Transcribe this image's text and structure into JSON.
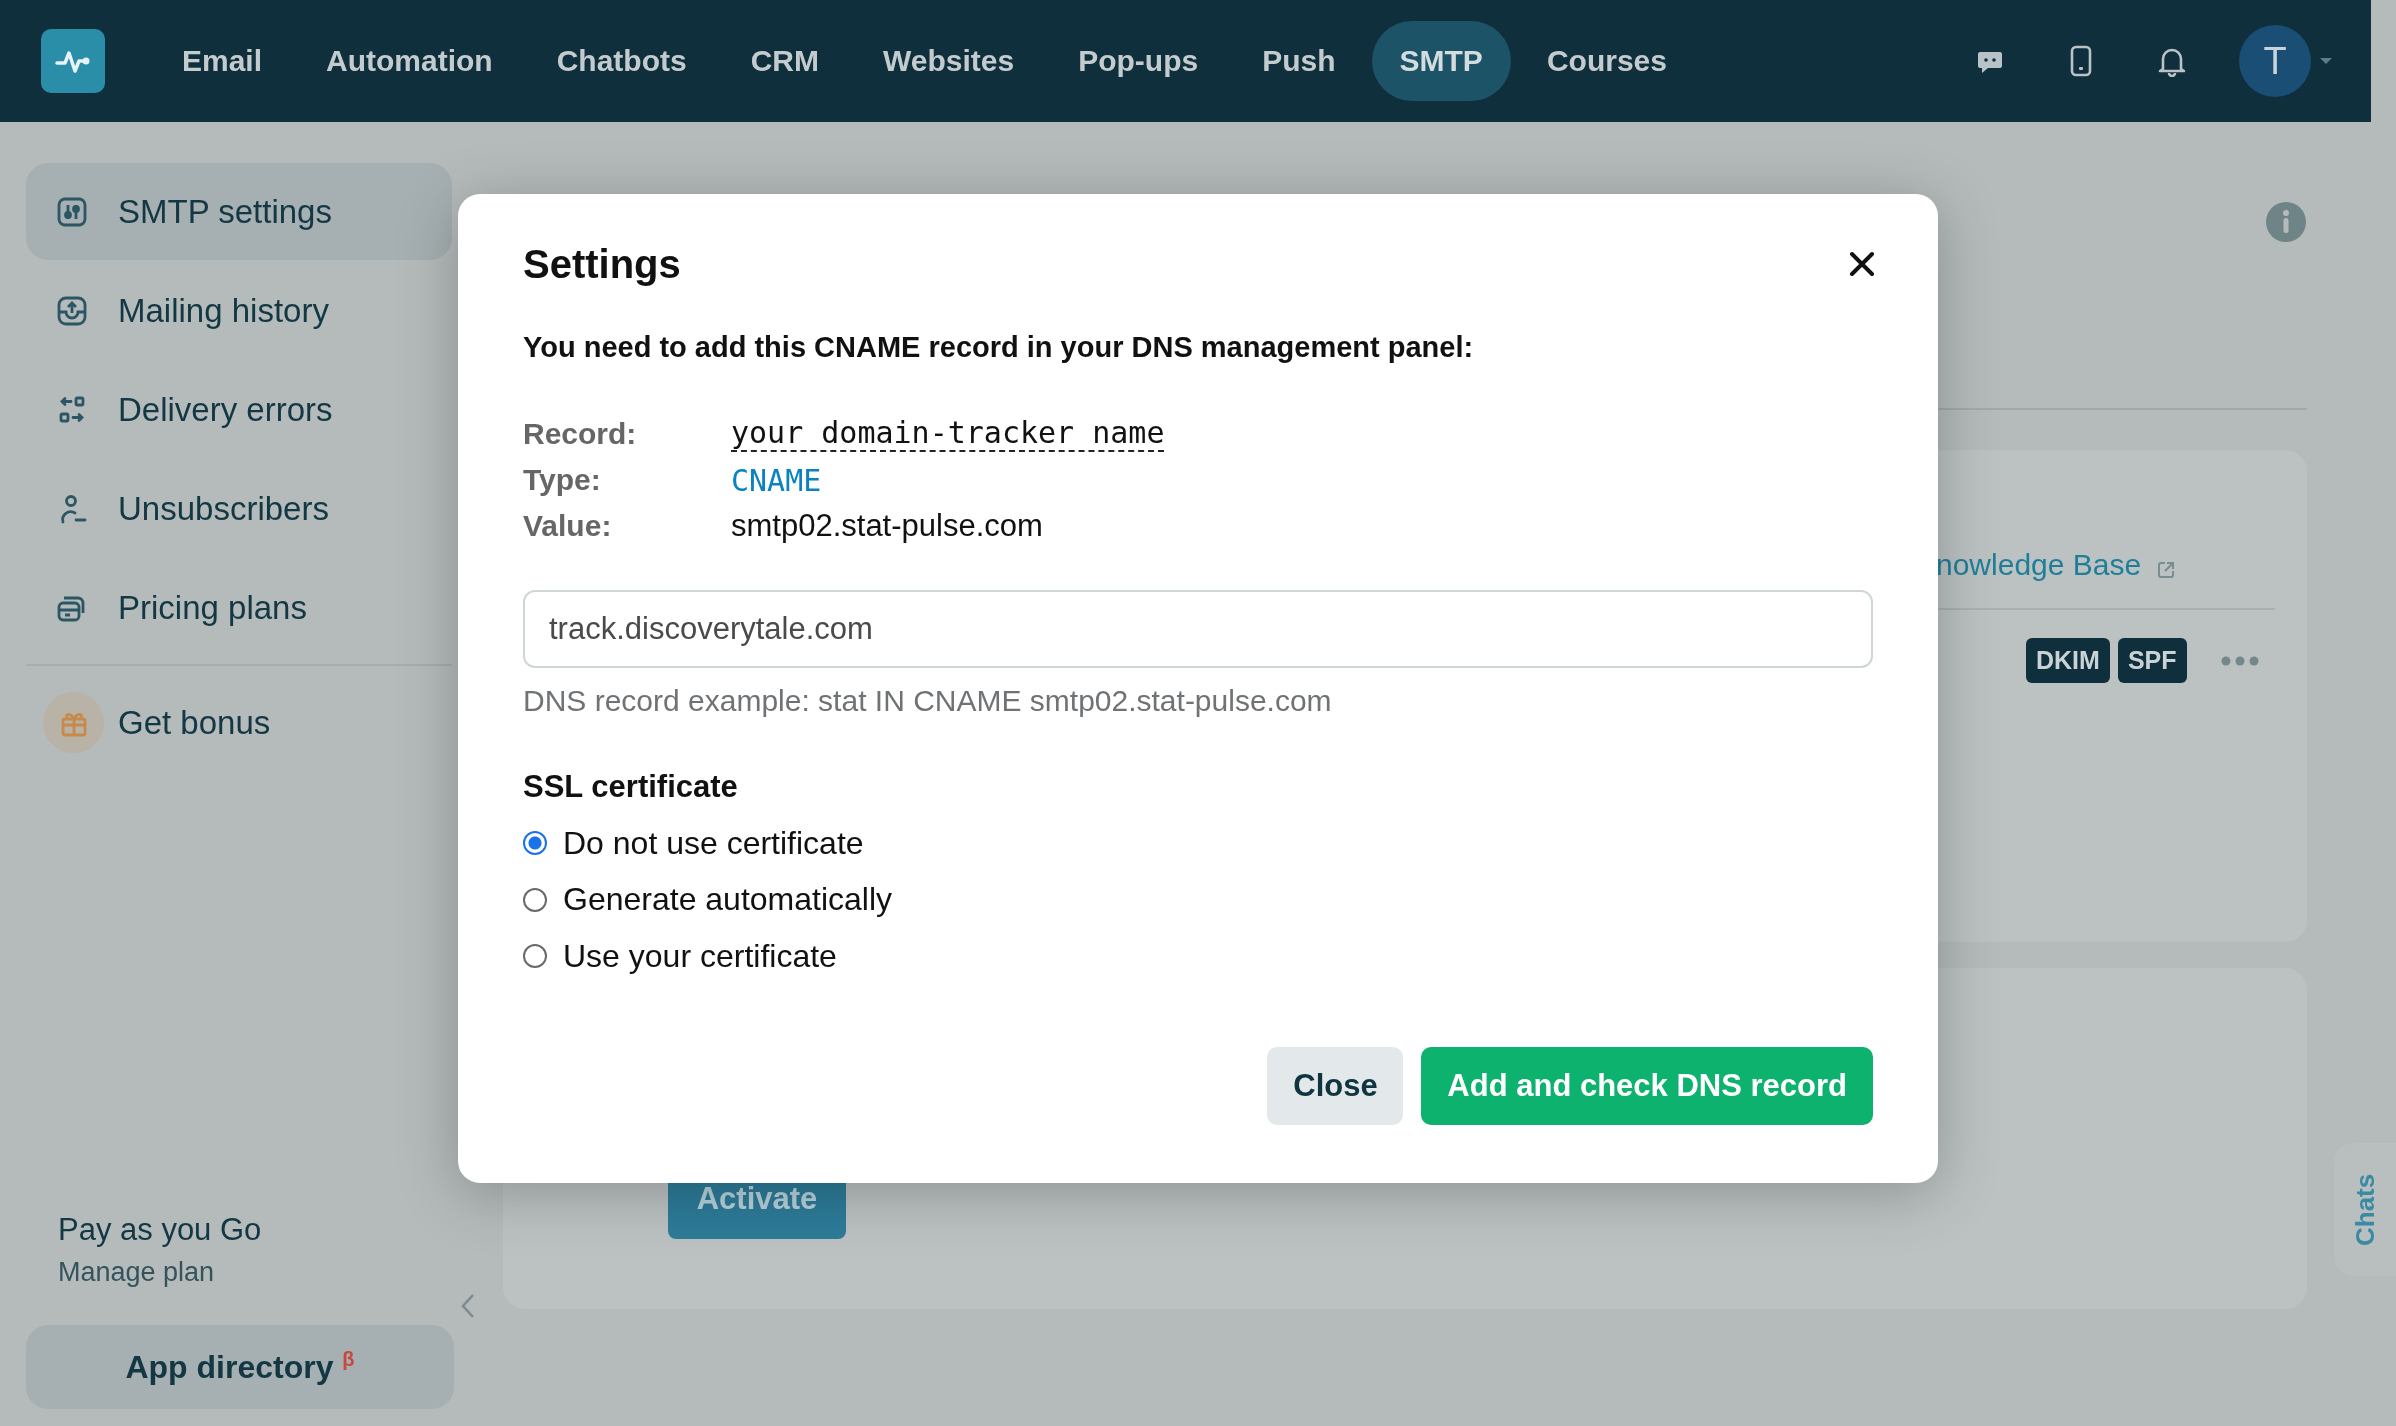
{
  "topbar": {
    "nav": [
      {
        "label": "Email",
        "selected": false
      },
      {
        "label": "Automation",
        "selected": false
      },
      {
        "label": "Chatbots",
        "selected": false
      },
      {
        "label": "CRM",
        "selected": false
      },
      {
        "label": "Websites",
        "selected": false
      },
      {
        "label": "Pop-ups",
        "selected": false
      },
      {
        "label": "Push",
        "selected": false
      },
      {
        "label": "SMTP",
        "selected": true
      },
      {
        "label": "Courses",
        "selected": false
      }
    ],
    "avatar": "T"
  },
  "sidebar": {
    "items": [
      {
        "label": "SMTP settings",
        "selected": true
      },
      {
        "label": "Mailing history",
        "selected": false
      },
      {
        "label": "Delivery errors",
        "selected": false
      },
      {
        "label": "Unsubscribers",
        "selected": false
      },
      {
        "label": "Pricing plans",
        "selected": false
      }
    ],
    "bonus": "Get bonus",
    "plan": {
      "name": "Pay as you Go",
      "link": "Manage plan"
    },
    "app_directory": "App directory $^{β}$"
  },
  "background": {
    "link": "nowledge Base",
    "tags": [
      "DKIM",
      "SPF"
    ],
    "activate": "Activate",
    "chats": "Chats"
  },
  "dialog": {
    "title": "Settings",
    "instruction": "You need to add this CNAME record in your DNS management panel:",
    "fields": [
      {
        "label": "Record:",
        "value": "your domain-tracker name",
        "kind": "placeholder"
      },
      {
        "label": "Type:",
        "value": "CNAME",
        "kind": "code"
      },
      {
        "label": "Value:",
        "value": "smtp02.stat-pulse.com",
        "kind": "plain"
      }
    ],
    "input": {
      "value": "track.discoverytale.com"
    },
    "hint": "DNS record example: stat IN CNAME smtp02.stat-pulse.com",
    "ssl": {
      "title": "SSL certificate",
      "options": [
        {
          "label": "Do not use certificate",
          "selected": true
        },
        {
          "label": "Generate automatically",
          "selected": false
        },
        {
          "label": "Use your certificate",
          "selected": false
        }
      ]
    },
    "buttons": [
      {
        "label": "Close",
        "kind": "secondary"
      },
      {
        "label": "Add and check DNS record",
        "kind": "primary"
      }
    ]
  }
}
